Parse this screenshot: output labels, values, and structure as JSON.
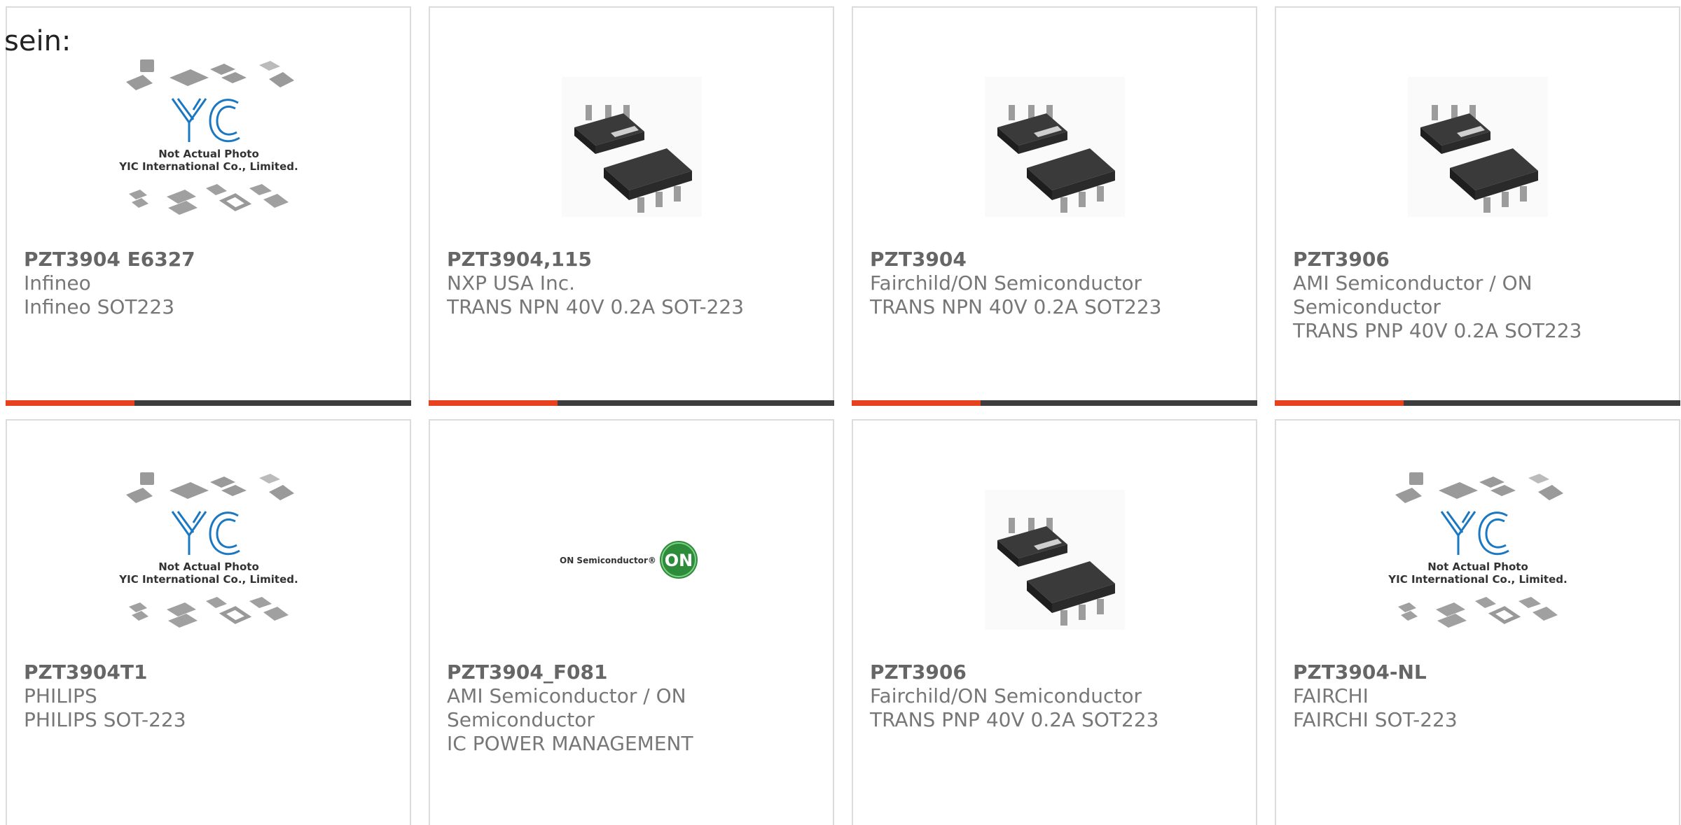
{
  "intro_text": "sein:",
  "products": [
    {
      "part": "PZT3904 E6327",
      "maker": "Infineo",
      "desc": "Infineo SOT223",
      "image": "yic-placeholder"
    },
    {
      "part": "PZT3904,115",
      "maker": "NXP USA Inc.",
      "desc": "TRANS NPN 40V 0.2A SOT-223",
      "image": "sot223-photo"
    },
    {
      "part": "PZT3904",
      "maker": "Fairchild/ON Semiconductor",
      "desc": "TRANS NPN 40V 0.2A SOT223",
      "image": "sot223-photo"
    },
    {
      "part": "PZT3906",
      "maker": "AMI Semiconductor / ON Semiconductor",
      "desc": "TRANS PNP 40V 0.2A SOT223",
      "image": "sot223-photo"
    },
    {
      "part": "PZT3904T1",
      "maker": "PHILIPS",
      "desc": "PHILIPS SOT-223",
      "image": "yic-placeholder"
    },
    {
      "part": "PZT3904_F081",
      "maker": "AMI Semiconductor / ON Semiconductor",
      "desc": "IC POWER MANAGEMENT",
      "image": "on-semi-logo"
    },
    {
      "part": "PZT3906",
      "maker": "Fairchild/ON Semiconductor",
      "desc": "TRANS PNP 40V 0.2A SOT223",
      "image": "sot223-photo"
    },
    {
      "part": "PZT3904-NL",
      "maker": "FAIRCHI",
      "desc": "FAIRCHI SOT-223",
      "image": "yic-placeholder"
    }
  ],
  "placeholder": {
    "line1": "Not Actual Photo",
    "line2": "YIC International Co., Limited.",
    "logo": "YIC"
  },
  "on_logo": {
    "wordmark": "ON Semiconductor®",
    "badge": "ON"
  },
  "colors": {
    "accent": "#e8411f",
    "bar_dark": "#3d3d3d",
    "border": "#dcdcdc",
    "text": "#777777"
  }
}
